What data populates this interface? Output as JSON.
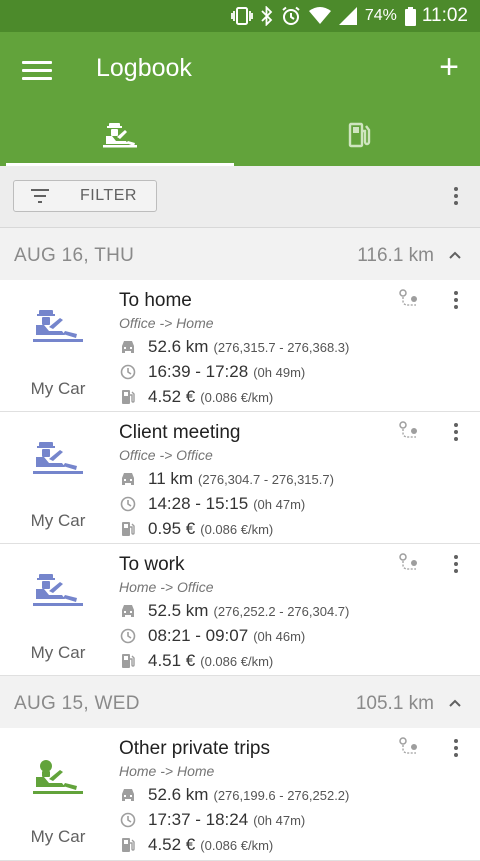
{
  "status": {
    "battery": "74%",
    "time": "11:02"
  },
  "appbar": {
    "title": "Logbook"
  },
  "filter": {
    "label": "FILTER"
  },
  "colors": {
    "primary": "#62a33b",
    "status": "#4c8a2b",
    "business": "#7585cc",
    "private": "#62a33b"
  },
  "days": [
    {
      "date": "AUG 16, THU",
      "total": "116.1 km",
      "trips": [
        {
          "name": "To home",
          "route": "Office -> Home",
          "distance": "52.6 km",
          "odometer": "(276,315.7 - 276,368.3)",
          "time": "16:39 - 17:28",
          "duration": "(0h 49m)",
          "cost": "4.52 €",
          "rate": "(0.086 €/km)",
          "car": "My Car",
          "type": "business"
        },
        {
          "name": "Client meeting",
          "route": "Office -> Office",
          "distance": "11 km",
          "odometer": "(276,304.7 - 276,315.7)",
          "time": "14:28 - 15:15",
          "duration": "(0h 47m)",
          "cost": "0.95 €",
          "rate": "(0.086 €/km)",
          "car": "My Car",
          "type": "business"
        },
        {
          "name": "To work",
          "route": "Home -> Office",
          "distance": "52.5 km",
          "odometer": "(276,252.2 - 276,304.7)",
          "time": "08:21 - 09:07",
          "duration": "(0h 46m)",
          "cost": "4.51 €",
          "rate": "(0.086 €/km)",
          "car": "My Car",
          "type": "business"
        }
      ]
    },
    {
      "date": "AUG 15, WED",
      "total": "105.1 km",
      "trips": [
        {
          "name": "Other private trips",
          "route": "Home -> Home",
          "distance": "52.6 km",
          "odometer": "(276,199.6 - 276,252.2)",
          "time": "17:37 - 18:24",
          "duration": "(0h 47m)",
          "cost": "4.52 €",
          "rate": "(0.086 €/km)",
          "car": "My Car",
          "type": "private"
        }
      ]
    }
  ]
}
